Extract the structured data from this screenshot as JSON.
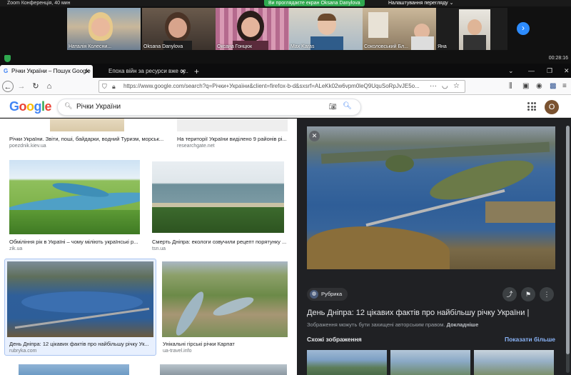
{
  "zoom": {
    "window_title": "Zoom Конференція, 40 мин",
    "share_banner": "Ви проглядаєте екран Oksana Danylova",
    "view_options": "Налаштування перегляду ⌄",
    "timer": "00:28:16",
    "participants": [
      {
        "name": "Наталія Колесни..."
      },
      {
        "name": "Oksana Danylova"
      },
      {
        "name": "Оксана Гонцюк"
      },
      {
        "name": "Max Karas"
      },
      {
        "name": "Соколовський Бл..."
      },
      {
        "name": "Яна"
      }
    ]
  },
  "browser": {
    "tabs": [
      {
        "label": "Річки України – Пошук Google"
      },
      {
        "label": "Епоха війн за ресурси вже су..."
      }
    ],
    "url": "https://www.google.com/search?q=Річки+України&client=firefox-b-d&sxsrf=ALeKk02w6vpm0leQ9UquSoRpJvJE5o..."
  },
  "google": {
    "logo": "Google",
    "query": "Річки України",
    "avatar_letter": "O",
    "results": [
      {
        "caption": "Річки України. Звіти, поші, байдарки, водний Туризм, морськ...",
        "domain": "poezdnik.kiev.ua"
      },
      {
        "caption": "На території України виділено 9 районів рі...",
        "domain": "researchgate.net"
      },
      {
        "caption": "Обміління рік в Україні – чому міліють українські р...",
        "domain": "zik.ua"
      },
      {
        "caption": "Смерть Дніпра: екологи озвучили рецепт порятунку ...",
        "domain": "tsn.ua"
      },
      {
        "caption": "День Дніпра: 12 цікавих фактів про найбільшу річку Ук...",
        "domain": "rubryka.com"
      },
      {
        "caption": "Унікальні гірські річки Карпат",
        "domain": "ua-travel.info"
      }
    ],
    "panel": {
      "source": "Рубрика",
      "title": "День Дніпра: 12 цікавих фактів про найбільшу річку України |",
      "copyright_prefix": "Зображення можуть бути захищені авторським правом.",
      "copyright_link": "Докладніше",
      "similar_label": "Схожі зображення",
      "show_more": "Показати більше"
    }
  }
}
